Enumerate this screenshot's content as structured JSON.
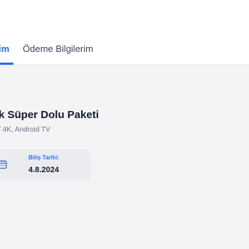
{
  "tabs": {
    "active_label": "im",
    "payment_label": "Ödeme Bilgilerim"
  },
  "package": {
    "title": "k Süper Dolu Paketi",
    "subtitle": "/ 4K, Android TV"
  },
  "end_date": {
    "label": "Bitiş Tarihi:",
    "value": "4.8.2024"
  },
  "colors": {
    "accent": "#1d6ff2",
    "background": "#f4f4f6",
    "card": "#ebecf0"
  },
  "icons": {
    "calendar": "calendar-icon"
  }
}
